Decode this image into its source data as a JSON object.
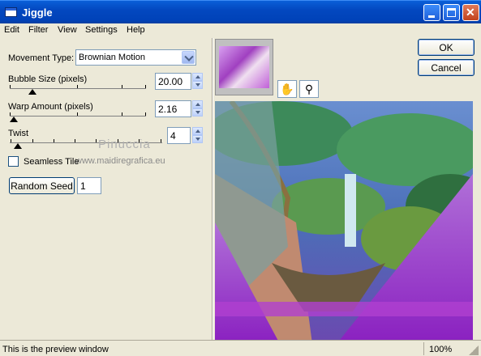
{
  "window": {
    "title": "Jiggle"
  },
  "menu": [
    "Edit",
    "Filter",
    "View",
    "Settings",
    "Help"
  ],
  "movement": {
    "label": "Movement Type:",
    "value": "Brownian Motion"
  },
  "bubble": {
    "label": "Bubble Size (pixels)",
    "value": "20.00"
  },
  "warp": {
    "label": "Warp Amount (pixels)",
    "value": "2.16"
  },
  "twist": {
    "label": "Twist",
    "value": "4"
  },
  "seamless": {
    "label": "Seamless Tile",
    "checked": false
  },
  "seed": {
    "button": "Random Seed",
    "value": "1"
  },
  "buttons": {
    "ok": "OK",
    "cancel": "Cancel"
  },
  "watermark": {
    "name": "Pinuccia",
    "url": "www.maidiregrafica.eu"
  },
  "status": {
    "text": "This is the preview window",
    "zoom": "100%"
  },
  "icons": {
    "hand": "hand-pan-icon",
    "zoom": "magnifier-icon"
  }
}
